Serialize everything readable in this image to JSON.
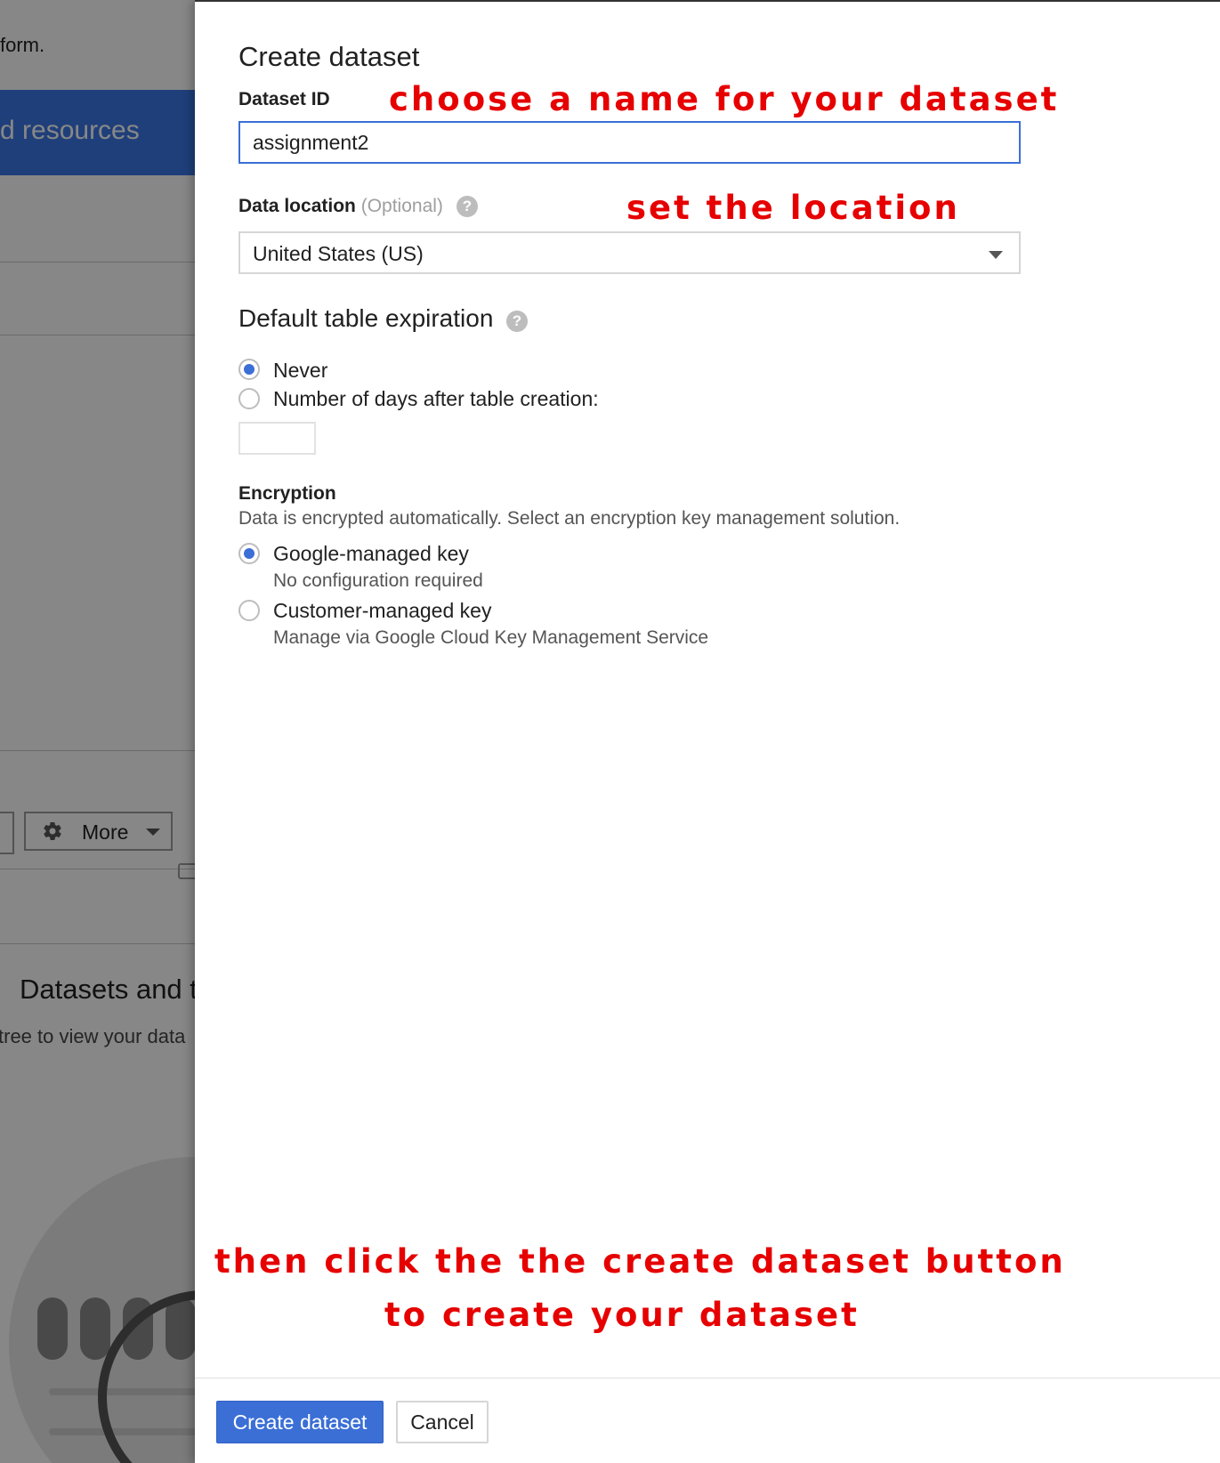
{
  "background": {
    "form_text": "form.",
    "banner_text": "d resources",
    "more_button_label": "More",
    "more_button_icon": "gear-icon",
    "datasets_heading": "Datasets and t",
    "tree_hint": "tree to view your data"
  },
  "dialog": {
    "title": "Create dataset",
    "dataset_id": {
      "label": "Dataset ID",
      "value": "assignment2"
    },
    "data_location": {
      "label": "Data location",
      "optional_text": "(Optional)",
      "help_icon": "help-icon",
      "selected": "United States (US)"
    },
    "expiration": {
      "title": "Default table expiration",
      "help_icon": "help-icon",
      "options": [
        {
          "label": "Never",
          "selected": true
        },
        {
          "label": "Number of days after table creation:",
          "selected": false
        }
      ],
      "days_value": ""
    },
    "encryption": {
      "title": "Encryption",
      "description": "Data is encrypted automatically. Select an encryption key management solution.",
      "options": [
        {
          "label": "Google-managed key",
          "sub": "No configuration required",
          "selected": true
        },
        {
          "label": "Customer-managed key",
          "sub": "Manage via Google Cloud Key Management Service",
          "selected": false
        }
      ]
    },
    "buttons": {
      "create": "Create dataset",
      "cancel": "Cancel"
    }
  },
  "annotations": {
    "name": "choose a name for your dataset",
    "location": "set the location",
    "click_line1": "then click the the create dataset button",
    "click_line2": "to create your dataset",
    "color": "#e60000"
  },
  "colors": {
    "primary": "#3b6fd6",
    "banner": "#3b78e7"
  }
}
